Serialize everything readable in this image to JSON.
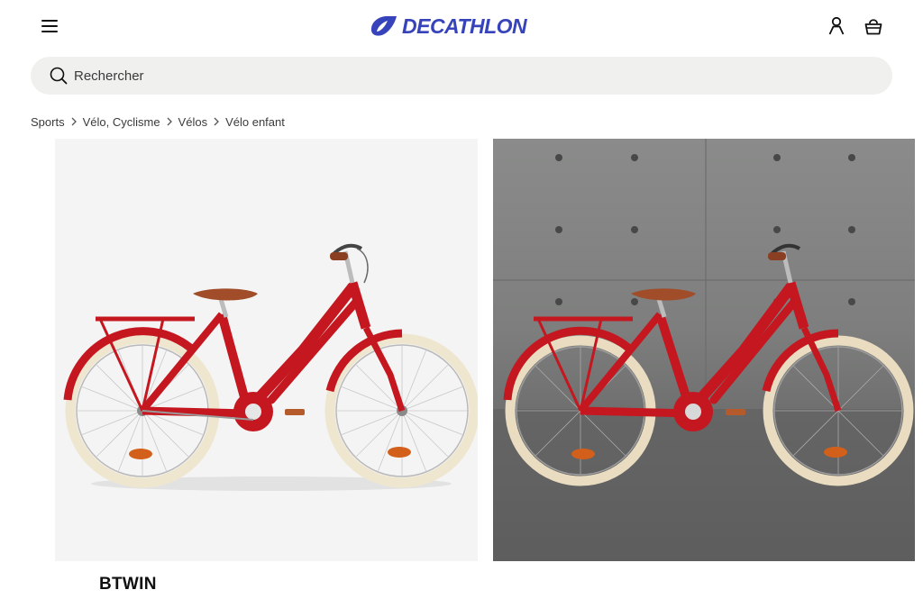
{
  "header": {
    "logo_text": "DECATHLON",
    "brand_color": "#3643ba",
    "menu_icon": "hamburger-menu-icon",
    "account_icon": "user-icon",
    "cart_icon": "shopping-bag-icon"
  },
  "search": {
    "placeholder": "Rechercher"
  },
  "breadcrumb": {
    "items": [
      "Sports",
      "Vélo, Cyclisme",
      "Vélos",
      "Vélo enfant"
    ]
  },
  "product": {
    "brand": "BTWIN",
    "bike_color": "#c5171f",
    "tire_color": "#efe6cf",
    "images": [
      "studio-white-background",
      "concrete-wall-background"
    ]
  }
}
